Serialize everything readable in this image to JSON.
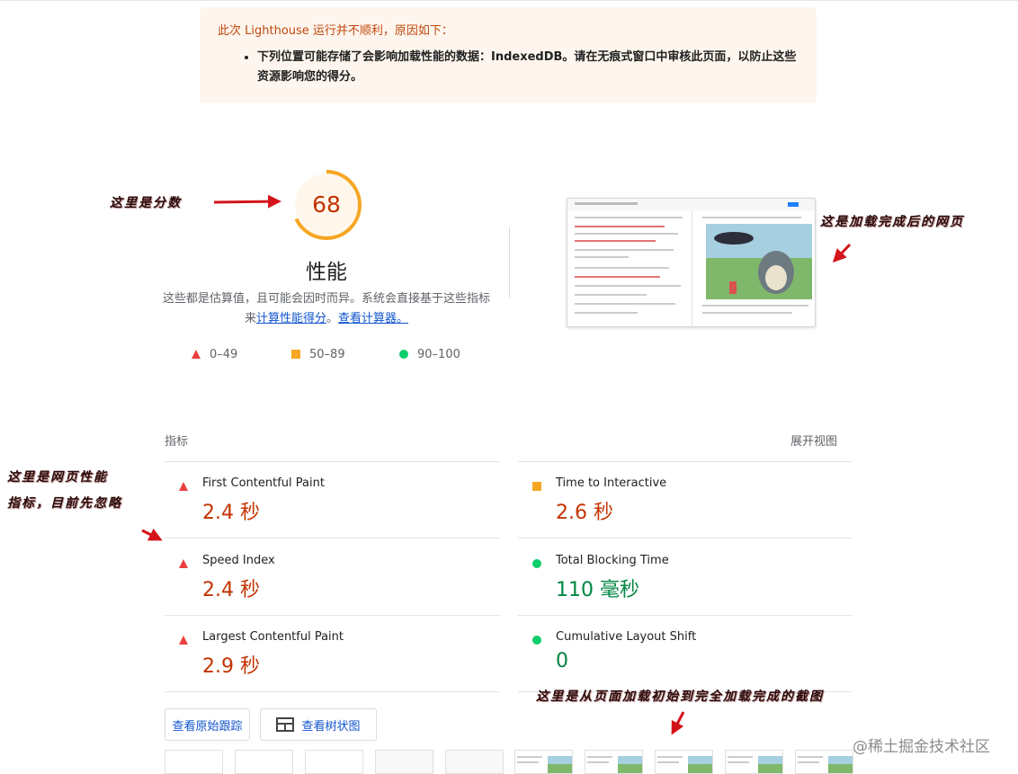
{
  "warning": {
    "title": "此次 Lighthouse 运行并不顺利，原因如下：",
    "item_line1": "下列位置可能存储了会影响加载性能的数据：IndexedDB。请在无痕式窗口中审核此页面，以防止这些",
    "item_line2": "资源影响您的得分。"
  },
  "score": {
    "value": "68",
    "fraction": 0.68,
    "title": "性能",
    "desc_prefix": "这些都是估算值，且可能会因时而异。系统会直接基于这些指标来",
    "desc_link1": "计算性能得分",
    "desc_mid": "。",
    "desc_link2": "查看计算器。",
    "color": "#f5a623"
  },
  "legend": {
    "fail": "0–49",
    "average": "50–89",
    "pass": "90–100"
  },
  "metrics": {
    "header": "指标",
    "expand_label": "展开视图",
    "fcp": {
      "label": "First Contentful Paint",
      "value": "2.4 秒"
    },
    "si": {
      "label": "Speed Index",
      "value": "2.4 秒"
    },
    "lcp": {
      "label": "Largest Contentful Paint",
      "value": "2.9 秒"
    },
    "tti": {
      "label": "Time to Interactive",
      "value": "2.6 秒"
    },
    "tbt": {
      "label": "Total Blocking Time",
      "value": "110 毫秒"
    },
    "cls": {
      "label": "Cumulative Layout Shift",
      "value": "0"
    }
  },
  "buttons": {
    "trace": "查看原始跟踪",
    "treemap": "查看树状图"
  },
  "annotations": {
    "score": "这里是分数",
    "final_screenshot": "这是加载完成后的网页",
    "metrics_line1": "这里是网页性能",
    "metrics_line2": "指标，目前先忽略",
    "filmstrip": "这里是从页面加载初始到完全加载完成的截图"
  },
  "watermark": "@稀土掘金技术社区",
  "colors": {
    "fail": "#eb3f3f",
    "average": "#f5a623",
    "pass": "#0cce6b",
    "link": "#1155cc"
  }
}
